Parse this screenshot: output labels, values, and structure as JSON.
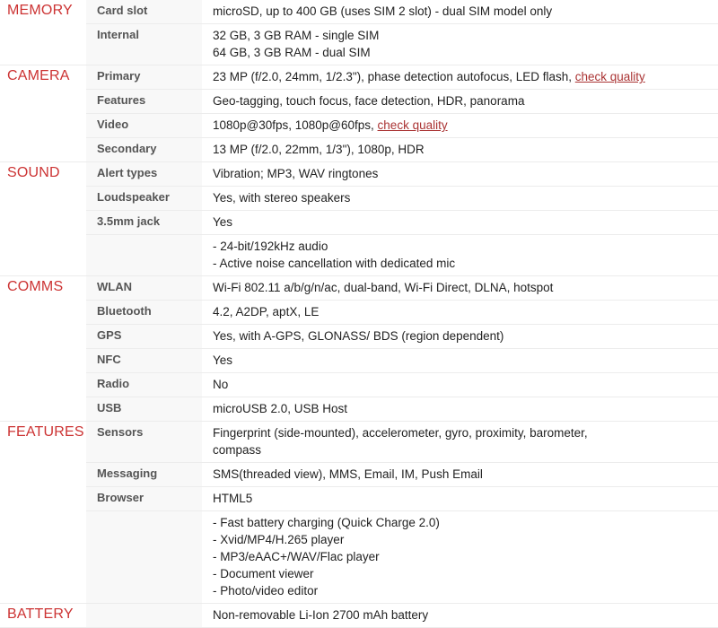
{
  "page": {
    "title": "Phone specifications table",
    "link_color": "#aa3333",
    "category_color": "#cc3333",
    "label_color": "#555555",
    "value_color": "#222222",
    "row_border_color": "#ececec",
    "label_bg": "#f8f8f8"
  },
  "link_label": "check quality",
  "sections": [
    {
      "category": "MEMORY",
      "rows": [
        {
          "label": "Card slot",
          "lines": [
            "microSD, up to 400 GB (uses SIM 2 slot) - dual SIM model only"
          ]
        },
        {
          "label": "Internal",
          "lines": [
            "32 GB, 3 GB RAM - single SIM",
            "64 GB, 3 GB RAM - dual SIM"
          ]
        }
      ]
    },
    {
      "category": "CAMERA",
      "rows": [
        {
          "label": "Primary",
          "lines": [
            "23 MP (f/2.0, 24mm, 1/2.3\"), phase detection autofocus, LED flash, "
          ],
          "link_after": true
        },
        {
          "label": "Features",
          "lines": [
            "Geo-tagging, touch focus, face detection, HDR, panorama"
          ]
        },
        {
          "label": "Video",
          "lines": [
            "1080p@30fps, 1080p@60fps, "
          ],
          "link_after": true
        },
        {
          "label": "Secondary",
          "lines": [
            "13 MP (f/2.0, 22mm, 1/3\"), 1080p, HDR"
          ]
        }
      ]
    },
    {
      "category": "SOUND",
      "rows": [
        {
          "label": "Alert types",
          "lines": [
            "Vibration; MP3, WAV ringtones"
          ]
        },
        {
          "label": "Loudspeaker",
          "lines": [
            "Yes, with stereo speakers"
          ]
        },
        {
          "label": "3.5mm jack",
          "lines": [
            "Yes"
          ]
        },
        {
          "label": "",
          "lines": [
            "- 24-bit/192kHz audio",
            "- Active noise cancellation with dedicated mic"
          ]
        }
      ]
    },
    {
      "category": "COMMS",
      "rows": [
        {
          "label": "WLAN",
          "lines": [
            "Wi-Fi 802.11 a/b/g/n/ac, dual-band, Wi-Fi Direct, DLNA, hotspot"
          ]
        },
        {
          "label": "Bluetooth",
          "lines": [
            "4.2, A2DP, aptX, LE"
          ]
        },
        {
          "label": "GPS",
          "lines": [
            "Yes, with A-GPS, GLONASS/ BDS (region dependent)"
          ]
        },
        {
          "label": "NFC",
          "lines": [
            "Yes"
          ]
        },
        {
          "label": "Radio",
          "lines": [
            "No"
          ]
        },
        {
          "label": "USB",
          "lines": [
            "microUSB 2.0, USB Host"
          ]
        }
      ]
    },
    {
      "category": "FEATURES",
      "indented": true,
      "rows": [
        {
          "label": "Sensors",
          "lines": [
            "Fingerprint (side-mounted), accelerometer, gyro, proximity, barometer,",
            "compass"
          ]
        },
        {
          "label": "Messaging",
          "lines": [
            "SMS(threaded view), MMS, Email, IM, Push Email"
          ]
        },
        {
          "label": "Browser",
          "lines": [
            "HTML5"
          ]
        },
        {
          "label": "",
          "lines": [
            "- Fast battery charging (Quick Charge 2.0)",
            "- Xvid/MP4/H.265 player",
            "- MP3/eAAC+/WAV/Flac player",
            "- Document viewer",
            "- Photo/video editor"
          ]
        }
      ]
    },
    {
      "category": "BATTERY",
      "rows": [
        {
          "label": "",
          "lines": [
            "Non-removable Li-Ion 2700 mAh battery"
          ]
        }
      ]
    }
  ]
}
